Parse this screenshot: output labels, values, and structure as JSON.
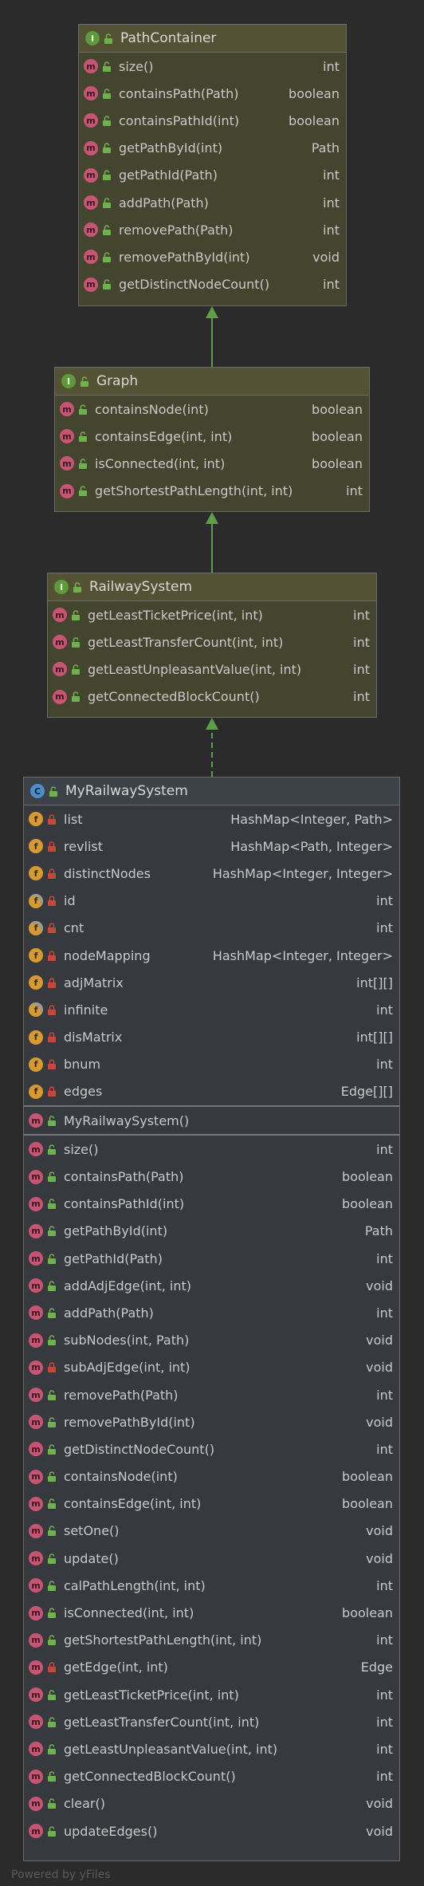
{
  "boxes": [
    {
      "name": "PathContainer",
      "kind": "interface",
      "fields": [],
      "methods": [
        {
          "name": "size()",
          "type": "int",
          "vis": "public"
        },
        {
          "name": "containsPath(Path)",
          "type": "boolean",
          "vis": "public"
        },
        {
          "name": "containsPathId(int)",
          "type": "boolean",
          "vis": "public"
        },
        {
          "name": "getPathById(int)",
          "type": "Path",
          "vis": "public"
        },
        {
          "name": "getPathId(Path)",
          "type": "int",
          "vis": "public"
        },
        {
          "name": "addPath(Path)",
          "type": "int",
          "vis": "public"
        },
        {
          "name": "removePath(Path)",
          "type": "int",
          "vis": "public"
        },
        {
          "name": "removePathById(int)",
          "type": "void",
          "vis": "public"
        },
        {
          "name": "getDistinctNodeCount()",
          "type": "int",
          "vis": "public"
        }
      ]
    },
    {
      "name": "Graph",
      "kind": "interface",
      "fields": [],
      "methods": [
        {
          "name": "containsNode(int)",
          "type": "boolean",
          "vis": "public"
        },
        {
          "name": "containsEdge(int, int)",
          "type": "boolean",
          "vis": "public"
        },
        {
          "name": "isConnected(int, int)",
          "type": "boolean",
          "vis": "public"
        },
        {
          "name": "getShortestPathLength(int, int)",
          "type": "int",
          "vis": "public"
        }
      ]
    },
    {
      "name": "RailwaySystem",
      "kind": "interface",
      "fields": [],
      "methods": [
        {
          "name": "getLeastTicketPrice(int, int)",
          "type": "int",
          "vis": "public"
        },
        {
          "name": "getLeastTransferCount(int, int)",
          "type": "int",
          "vis": "public"
        },
        {
          "name": "getLeastUnpleasantValue(int, int)",
          "type": "int",
          "vis": "public"
        },
        {
          "name": "getConnectedBlockCount()",
          "type": "int",
          "vis": "public"
        }
      ]
    },
    {
      "name": "MyRailwaySystem",
      "kind": "class",
      "fields": [
        {
          "name": "list",
          "type": "HashMap<Integer, Path>",
          "vis": "private",
          "static": false
        },
        {
          "name": "revlist",
          "type": "HashMap<Path, Integer>",
          "vis": "private",
          "static": false
        },
        {
          "name": "distinctNodes",
          "type": "HashMap<Integer, Integer>",
          "vis": "private",
          "static": false
        },
        {
          "name": "id",
          "type": "int",
          "vis": "private",
          "static": true
        },
        {
          "name": "cnt",
          "type": "int",
          "vis": "private",
          "static": true
        },
        {
          "name": "nodeMapping",
          "type": "HashMap<Integer, Integer>",
          "vis": "private",
          "static": false
        },
        {
          "name": "adjMatrix",
          "type": "int[][]",
          "vis": "private",
          "static": false
        },
        {
          "name": "infinite",
          "type": "int",
          "vis": "private",
          "static": true
        },
        {
          "name": "disMatrix",
          "type": "int[][]",
          "vis": "private",
          "static": false
        },
        {
          "name": "bnum",
          "type": "int",
          "vis": "private",
          "static": false
        },
        {
          "name": "edges",
          "type": "Edge[][]",
          "vis": "private",
          "static": false
        }
      ],
      "constructors": [
        {
          "name": "MyRailwaySystem()",
          "type": "",
          "vis": "public"
        }
      ],
      "methods": [
        {
          "name": "size()",
          "type": "int",
          "vis": "public"
        },
        {
          "name": "containsPath(Path)",
          "type": "boolean",
          "vis": "public"
        },
        {
          "name": "containsPathId(int)",
          "type": "boolean",
          "vis": "public"
        },
        {
          "name": "getPathById(int)",
          "type": "Path",
          "vis": "public"
        },
        {
          "name": "getPathId(Path)",
          "type": "int",
          "vis": "public"
        },
        {
          "name": "addAdjEdge(int, int)",
          "type": "void",
          "vis": "public"
        },
        {
          "name": "addPath(Path)",
          "type": "int",
          "vis": "public"
        },
        {
          "name": "subNodes(int, Path)",
          "type": "void",
          "vis": "public"
        },
        {
          "name": "subAdjEdge(int, int)",
          "type": "void",
          "vis": "private"
        },
        {
          "name": "removePath(Path)",
          "type": "int",
          "vis": "public"
        },
        {
          "name": "removePathById(int)",
          "type": "void",
          "vis": "public"
        },
        {
          "name": "getDistinctNodeCount()",
          "type": "int",
          "vis": "public"
        },
        {
          "name": "containsNode(int)",
          "type": "boolean",
          "vis": "public"
        },
        {
          "name": "containsEdge(int, int)",
          "type": "boolean",
          "vis": "public"
        },
        {
          "name": "setOne()",
          "type": "void",
          "vis": "public"
        },
        {
          "name": "update()",
          "type": "void",
          "vis": "public"
        },
        {
          "name": "calPathLength(int, int)",
          "type": "int",
          "vis": "public"
        },
        {
          "name": "isConnected(int, int)",
          "type": "boolean",
          "vis": "public"
        },
        {
          "name": "getShortestPathLength(int, int)",
          "type": "int",
          "vis": "public"
        },
        {
          "name": "getEdge(int, int)",
          "type": "Edge",
          "vis": "private"
        },
        {
          "name": "getLeastTicketPrice(int, int)",
          "type": "int",
          "vis": "public"
        },
        {
          "name": "getLeastTransferCount(int, int)",
          "type": "int",
          "vis": "public"
        },
        {
          "name": "getLeastUnpleasantValue(int, int)",
          "type": "int",
          "vis": "public"
        },
        {
          "name": "getConnectedBlockCount()",
          "type": "int",
          "vis": "public"
        },
        {
          "name": "clear()",
          "type": "void",
          "vis": "public"
        },
        {
          "name": "updateEdges()",
          "type": "void",
          "vis": "public"
        }
      ]
    }
  ],
  "badges": {
    "interface": "I",
    "class": "C",
    "method": "m",
    "field": "f"
  },
  "colors": {
    "edge": "#5e9e46",
    "iface_bg": "#44452f",
    "class_bg": "#363a3f"
  },
  "footer": "Powered by yFiles"
}
